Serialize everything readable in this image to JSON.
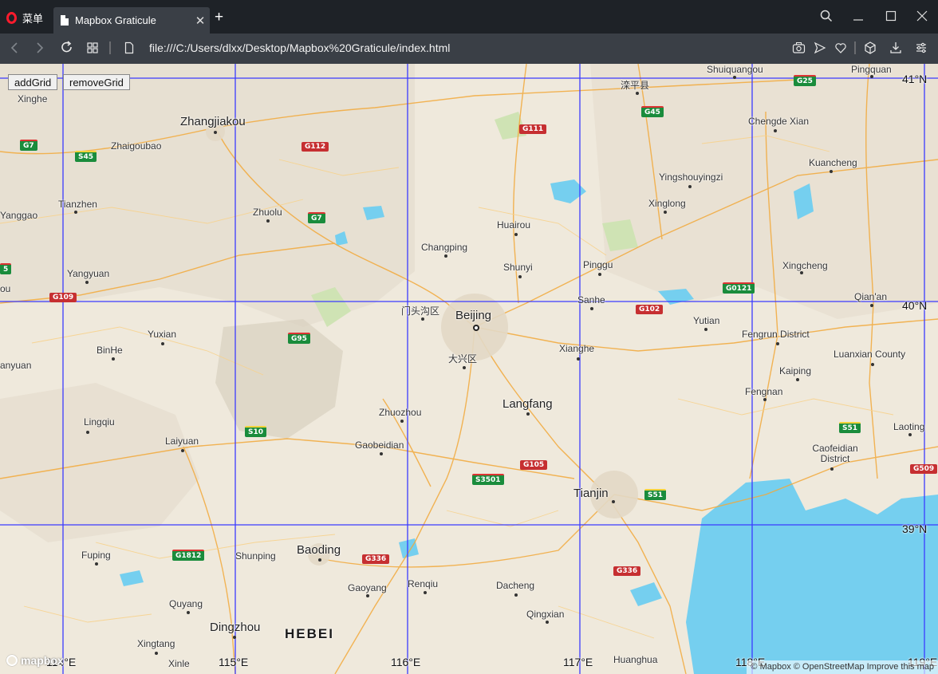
{
  "browser": {
    "menu_label": "菜单",
    "tab_title": "Mapbox Graticule",
    "tab_close": "✕",
    "new_tab": "+",
    "url": "file:///C:/Users/dlxx/Desktop/Mapbox%20Graticule/index.html",
    "icons": [
      "back-icon",
      "forward-icon",
      "reload-icon",
      "speed-dial-icon",
      "page-icon",
      "snapshot-icon",
      "send-icon",
      "heart-icon",
      "box-icon",
      "download-icon",
      "settings-icon",
      "search-icon",
      "minimize-icon",
      "maximize-icon",
      "close-window-icon"
    ]
  },
  "controls": {
    "add_label": "addGrid",
    "remove_label": "removeGrid"
  },
  "map": {
    "colors": {
      "land": "#efe9dc",
      "water": "#75cfef",
      "grid": "#3b3bff",
      "road_major": "#f2a93b",
      "road_minor": "#f7d28c"
    },
    "graticule": {
      "lat_labels": [
        "41°N",
        "40°N",
        "39°N"
      ],
      "lon_labels": [
        "114°E",
        "115°E",
        "116°E",
        "117°E",
        "118°E",
        "119°E"
      ]
    },
    "places": [
      {
        "name": "Xinghe"
      },
      {
        "name": "Zhangjiakou"
      },
      {
        "name": "Zhaigoubao"
      },
      {
        "name": "Tianzhen"
      },
      {
        "name": "Yanggao"
      },
      {
        "name": "Zhuolu"
      },
      {
        "name": "Yangyuan"
      },
      {
        "name": "Yuxian"
      },
      {
        "name": "BinHe"
      },
      {
        "name": "anyuan"
      },
      {
        "name": "Lingqiu"
      },
      {
        "name": "Laiyuan"
      },
      {
        "name": "Fuping"
      },
      {
        "name": "Quyang"
      },
      {
        "name": "Xingtang"
      },
      {
        "name": "Xinle"
      },
      {
        "name": "Dingzhou"
      },
      {
        "name": "Shunping"
      },
      {
        "name": "Baoding"
      },
      {
        "name": "HEBEI"
      },
      {
        "name": "Gaoyang"
      },
      {
        "name": "Renqiu"
      },
      {
        "name": "Dacheng"
      },
      {
        "name": "Qingxian"
      },
      {
        "name": "Huanghua"
      },
      {
        "name": "Zhuozhou"
      },
      {
        "name": "Gaobeidian"
      },
      {
        "name": "Langfang"
      },
      {
        "name": "Tianjin"
      },
      {
        "name": "Xianghe"
      },
      {
        "name": "Beijing"
      },
      {
        "name": "门头沟区"
      },
      {
        "name": "大兴区"
      },
      {
        "name": "Changping"
      },
      {
        "name": "Shunyi"
      },
      {
        "name": "Huairou"
      },
      {
        "name": "Pinggu"
      },
      {
        "name": "Sanhe"
      },
      {
        "name": "Yutian"
      },
      {
        "name": "Xinglong"
      },
      {
        "name": "Yingshouyingzi"
      },
      {
        "name": "Chengde Xian"
      },
      {
        "name": "Kuancheng"
      },
      {
        "name": "滦平县"
      },
      {
        "name": "Shuiquangou"
      },
      {
        "name": "Pingquan"
      },
      {
        "name": "Xingcheng"
      },
      {
        "name": "Qian'an"
      },
      {
        "name": "Fengrun District"
      },
      {
        "name": "Luanxian County"
      },
      {
        "name": "Kaiping"
      },
      {
        "name": "Fengnan"
      },
      {
        "name": "Laoting"
      },
      {
        "name": "Caofeidian District"
      },
      {
        "name": "ou"
      }
    ],
    "shields": [
      "G7",
      "S45",
      "G112",
      "G111",
      "G45",
      "G25",
      "G7",
      "G109",
      "G95",
      "G0121",
      "G102",
      "S10",
      "S3501",
      "G105",
      "S51",
      "S51",
      "G1812",
      "G336",
      "G336",
      "G509",
      "5"
    ],
    "attribution": "© Mapbox © OpenStreetMap Improve this map",
    "logo_text": "mapbox"
  }
}
